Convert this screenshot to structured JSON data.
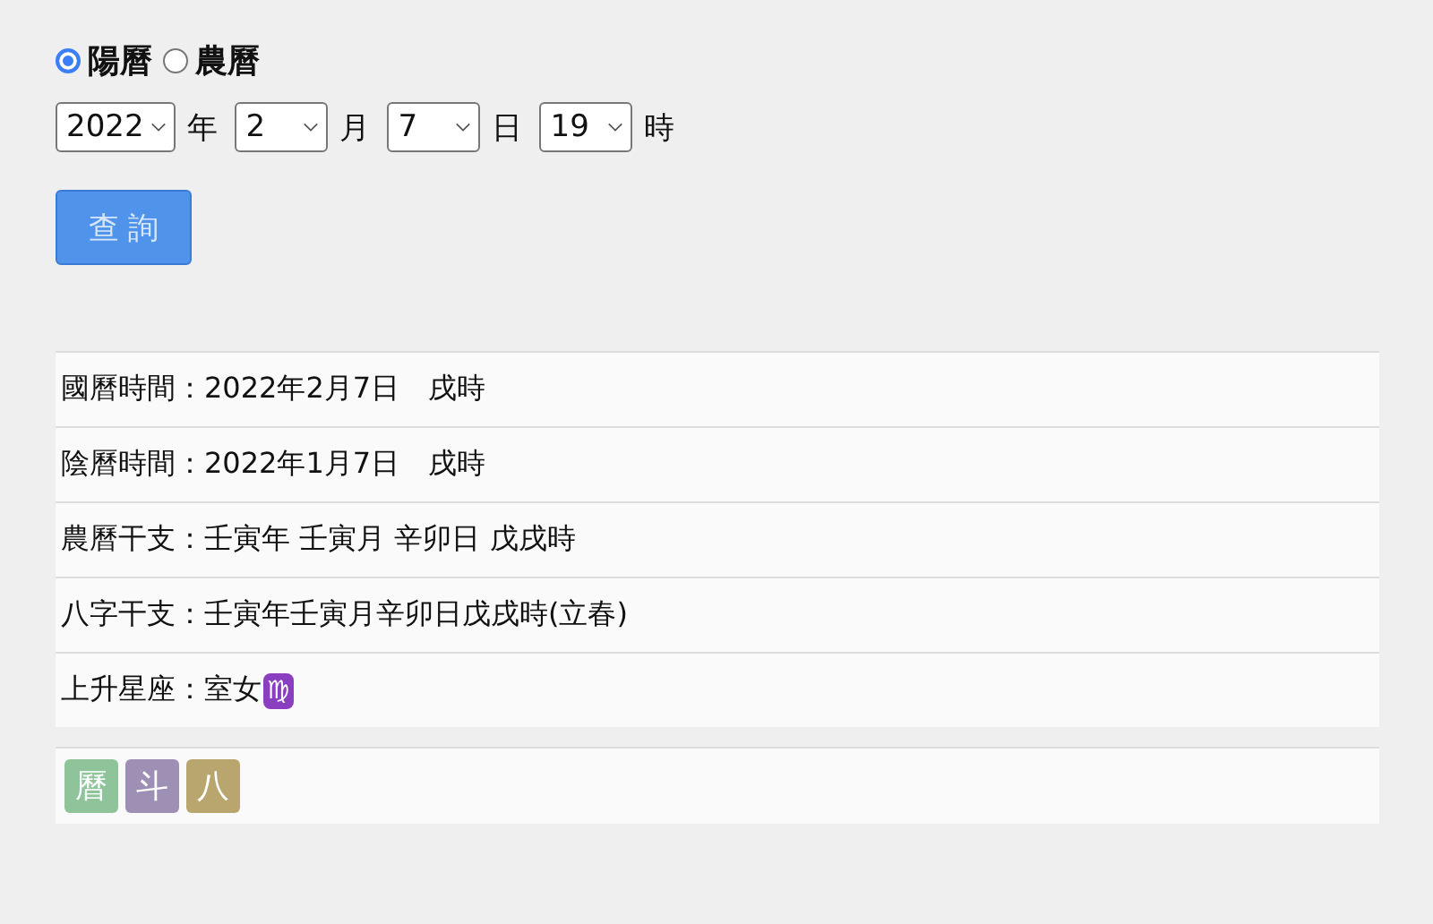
{
  "calendar_options": [
    {
      "label": "陽曆",
      "selected": true
    },
    {
      "label": "農曆",
      "selected": false
    }
  ],
  "date_selects": [
    {
      "value": "2022",
      "unit": "年"
    },
    {
      "value": "2",
      "unit": "月"
    },
    {
      "value": "7",
      "unit": "日"
    },
    {
      "value": "19",
      "unit": "時"
    }
  ],
  "query_button": "查 詢",
  "results": [
    {
      "text": "國曆時間：2022年2月7日　戌時"
    },
    {
      "text": "陰曆時間：2022年1月7日　戌時"
    },
    {
      "text": "農曆干支：壬寅年 壬寅月 辛卯日 戊戌時"
    },
    {
      "text": "八字干支：壬寅年壬寅月辛卯日戊戌時(立春)"
    },
    {
      "text": "上升星座：室女",
      "symbol": "♍"
    }
  ],
  "app_tiles": [
    {
      "label": "曆",
      "color": "#8fc49a"
    },
    {
      "label": "斗",
      "color": "#9d90b4"
    },
    {
      "label": "八",
      "color": "#b9a66e"
    }
  ]
}
